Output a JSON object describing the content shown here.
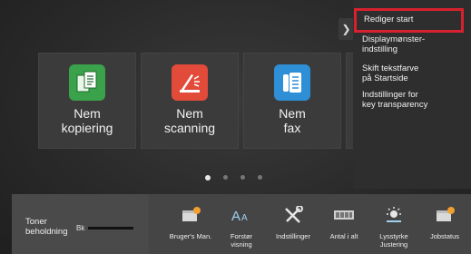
{
  "tiles": [
    {
      "id": "copy",
      "label": "Nem\nkopiering",
      "icon": "copy-icon",
      "color": "#3aa24a"
    },
    {
      "id": "scan",
      "label": "Nem\nscanning",
      "icon": "scan-icon",
      "color": "#e24a3a"
    },
    {
      "id": "fax",
      "label": "Nem\nfax",
      "icon": "fax-icon",
      "color": "#2e8fd6"
    }
  ],
  "side_menu": {
    "items": [
      "Rediger start",
      "Displaymønster-\nindstilling",
      "Skift tekstfarve\npå Startside",
      "Indstillinger for\nkey transparency"
    ],
    "highlight_color": "#d8212e"
  },
  "pagination": {
    "total": 4,
    "current": 1
  },
  "toner": {
    "label": "Toner\nbeholdning",
    "color_code": "Bk"
  },
  "bottom_bar": {
    "manual": "Bruger's Man.",
    "zoom": "Forstør\nvisning",
    "settings": "Indstillinger",
    "count": "Antal i alt",
    "brightness": "Lysstyrke\nJustering",
    "jobs": "Jobstatus"
  }
}
